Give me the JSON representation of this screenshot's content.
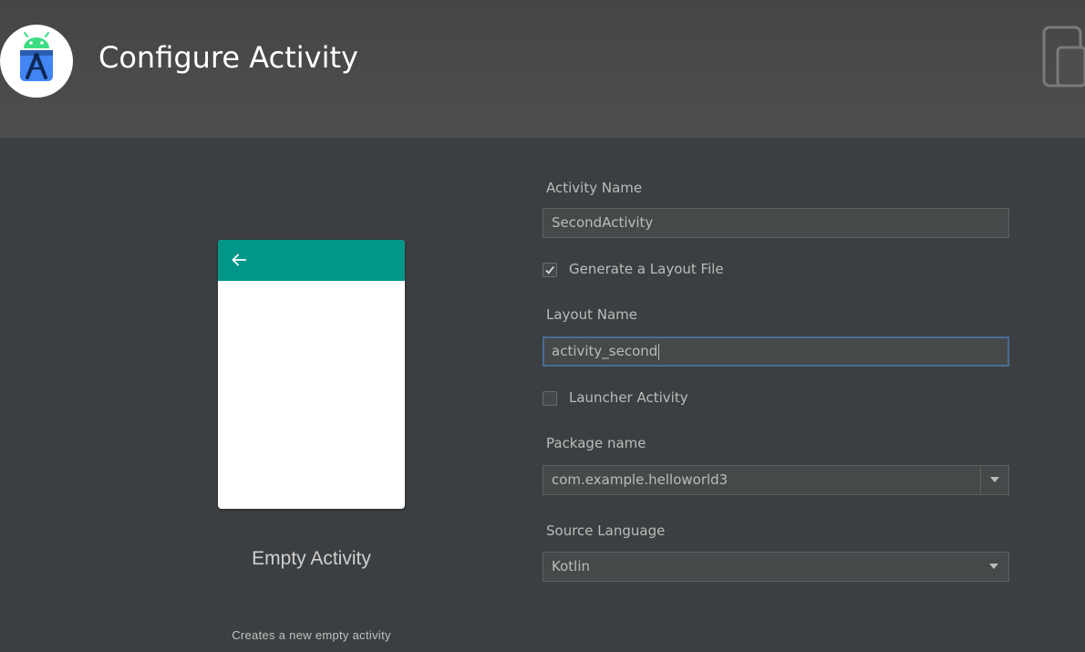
{
  "header": {
    "title": "Configure Activity",
    "logo_icon": "android-studio-logo-icon",
    "device_icon": "device-frame-icon"
  },
  "preview": {
    "appbar_color": "#009688",
    "back_icon": "arrow-back-icon",
    "template_name": "Empty Activity",
    "template_description": "Creates a new empty activity"
  },
  "form": {
    "activity_name": {
      "label": "Activity Name",
      "value": "SecondActivity"
    },
    "generate_layout": {
      "label": "Generate a Layout File",
      "checked": true
    },
    "layout_name": {
      "label": "Layout Name",
      "value": "activity_second",
      "focused": true
    },
    "launcher_activity": {
      "label": "Launcher Activity",
      "checked": false
    },
    "package_name": {
      "label": "Package name",
      "value": "com.example.helloworld3"
    },
    "source_language": {
      "label": "Source Language",
      "value": "Kotlin"
    }
  },
  "colors": {
    "background": "#3c3f41",
    "header": "#4b4b4b",
    "focus_border": "#466d94",
    "field_bg": "#45494a"
  }
}
